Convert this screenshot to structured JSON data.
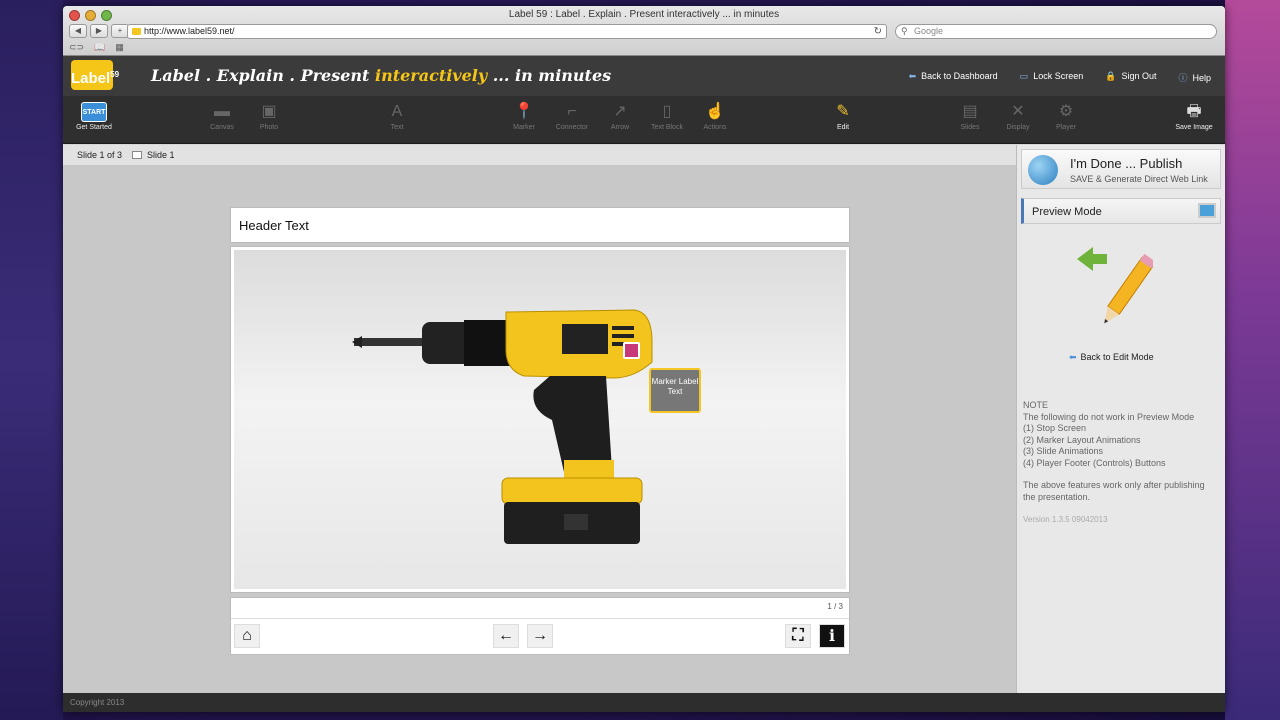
{
  "browser": {
    "title": "Label 59 : Label . Explain . Present interactively ... in minutes",
    "url": "http://www.label59.net/",
    "search_placeholder": "Google"
  },
  "app": {
    "logo_text": "Label",
    "logo_sup": "59",
    "tagline_part1": "Label . Explain . Present",
    "tagline_highlight": "interactively",
    "tagline_part2": "... in minutes",
    "links": {
      "dashboard": "Back to Dashboard",
      "lock": "Lock Screen",
      "signout": "Sign Out",
      "help": "Help"
    }
  },
  "toolbar": {
    "start_icon": "START",
    "get_started": "Get Started",
    "canvas": "Canvas",
    "photo": "Photo",
    "text": "Text",
    "marker": "Marker",
    "connector": "Connector",
    "arrow": "Arrow",
    "text_block": "Text Block",
    "actions": "Actions",
    "edit": "Edit",
    "slides": "Slides",
    "display": "Display",
    "player": "Player",
    "save_image": "Save Image"
  },
  "slidebar": {
    "position": "Slide 1 of 3",
    "current": "Slide 1"
  },
  "slide": {
    "header_text": "Header Text",
    "marker_label": "Marker Label Text",
    "page_indicator": "1 / 3"
  },
  "panel": {
    "publish_title": "I'm Done ... Publish",
    "publish_sub": "SAVE & Generate Direct Web Link",
    "preview_mode": "Preview Mode",
    "back_to_edit": "Back to Edit Mode",
    "note_title": "NOTE",
    "note_line1": "The following do not work in Preview Mode",
    "note_item1": "(1) Stop Screen",
    "note_item2": "(2) Marker Layout Animations",
    "note_item3": "(3) Slide Animations",
    "note_item4": "(4) Player Footer (Controls) Buttons",
    "note_after": "The above features work only after publishing the presentation.",
    "version": "Version 1.3.5 09042013"
  },
  "footer": {
    "copyright": "Copyright 2013"
  }
}
